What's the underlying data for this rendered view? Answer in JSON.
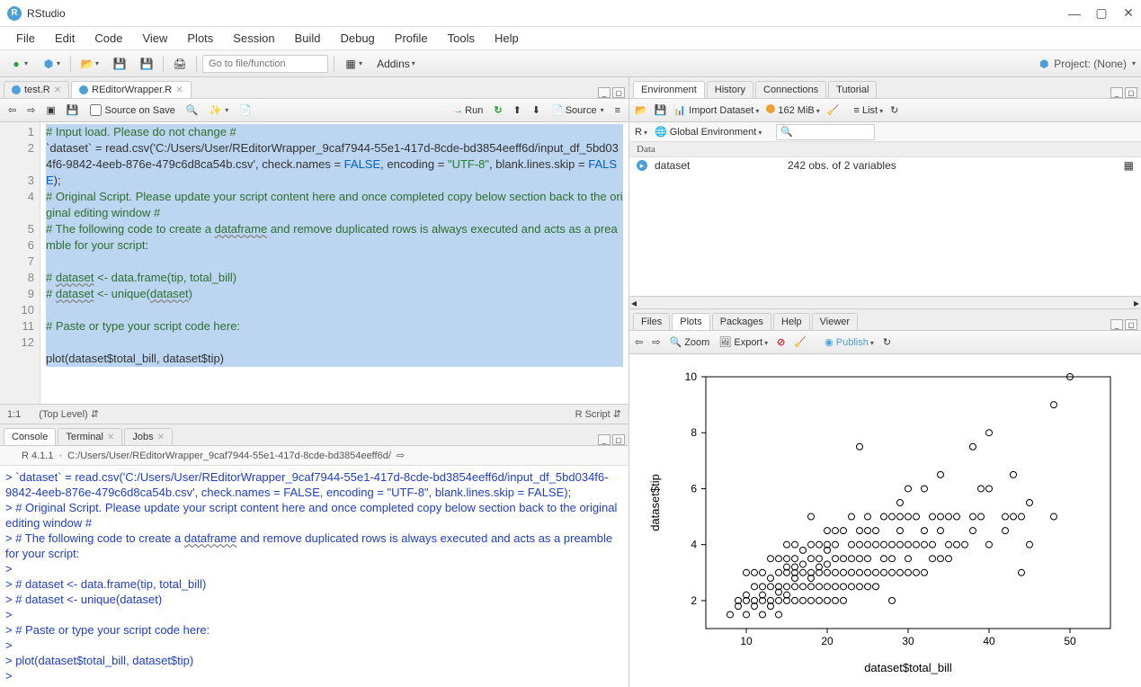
{
  "window": {
    "title": "RStudio"
  },
  "menubar": [
    "File",
    "Edit",
    "Code",
    "View",
    "Plots",
    "Session",
    "Build",
    "Debug",
    "Profile",
    "Tools",
    "Help"
  ],
  "global_toolbar": {
    "goto_placeholder": "Go to file/function",
    "addins": "Addins",
    "project": "Project: (None)"
  },
  "source": {
    "tabs": [
      {
        "label": "test.R",
        "active": false
      },
      {
        "label": "REditorWrapper.R",
        "active": true
      }
    ],
    "source_on_save": "Source on Save",
    "run_label": "Run",
    "source_label": "Source",
    "line_numbers": [
      "1",
      "2",
      "",
      "3",
      "4",
      "",
      "5",
      "6",
      "7",
      "8",
      "9",
      "10",
      "11",
      "12"
    ],
    "code_lines": [
      "# Input load. Please do not change #",
      "`dataset` = read.csv('C:/Users/User/REditorWrapper_9caf7944-55e1-417d-8cde-bd3854eeff6d/input_df_5bd034f6-9842-4eeb-876e-479c6d8ca54b.csv', check.names = FALSE, encoding = \"UTF-8\", blank.lines.skip = FALSE);",
      "# Original Script. Please update your script content here and once completed copy below section back to the original editing window #",
      "# The following code to create a dataframe and remove duplicated rows is always executed and acts as a preamble for your script:",
      "",
      "# dataset <- data.frame(tip, total_bill)",
      "# dataset <- unique(dataset)",
      "",
      "# Paste or type your script code here:",
      "",
      "plot(dataset$total_bill, dataset$tip)",
      ""
    ],
    "status_pos": "1:1",
    "status_scope": "(Top Level)",
    "status_lang": "R Script"
  },
  "console": {
    "tabs": [
      "Console",
      "Terminal",
      "Jobs"
    ],
    "version": "R 4.1.1",
    "path": "C:/Users/User/REditorWrapper_9caf7944-55e1-417d-8cde-bd3854eeff6d/",
    "lines": [
      "> `dataset` = read.csv('C:/Users/User/REditorWrapper_9caf7944-55e1-417d-8cde-bd3854eeff6d/input_df_5bd034f6-9842-4eeb-876e-479c6d8ca54b.csv', check.names = FALSE, encoding = \"UTF-8\", blank.lines.skip = FALSE);",
      "> # Original Script. Please update your script content here and once completed copy below section back to the original editing window #",
      "> # The following code to create a dataframe and remove duplicated rows is always executed and acts as a preamble for your script:",
      "> ",
      "> # dataset <- data.frame(tip, total_bill)",
      "> # dataset <- unique(dataset)",
      "> ",
      "> # Paste or type your script code here:",
      "> ",
      "> plot(dataset$total_bill, dataset$tip)",
      "> "
    ]
  },
  "environment": {
    "tabs": [
      "Environment",
      "History",
      "Connections",
      "Tutorial"
    ],
    "import": "Import Dataset",
    "memory": "162 MiB",
    "scope_r": "R",
    "scope_env": "Global Environment",
    "view_mode": "List",
    "section": "Data",
    "var_name": "dataset",
    "var_desc": "242 obs. of 2 variables"
  },
  "plots": {
    "tabs": [
      "Files",
      "Plots",
      "Packages",
      "Help",
      "Viewer"
    ],
    "zoom": "Zoom",
    "export": "Export",
    "publish": "Publish"
  },
  "chart_data": {
    "type": "scatter",
    "xlabel": "dataset$total_bill",
    "ylabel": "dataset$tip",
    "xlim": [
      5,
      55
    ],
    "ylim": [
      1,
      10
    ],
    "xticks": [
      10,
      20,
      30,
      40,
      50
    ],
    "yticks": [
      2,
      4,
      6,
      8,
      10
    ],
    "points": [
      [
        8,
        1.5
      ],
      [
        9,
        1.8
      ],
      [
        9,
        2.0
      ],
      [
        10,
        1.5
      ],
      [
        10,
        2.0
      ],
      [
        10,
        2.2
      ],
      [
        10,
        3.0
      ],
      [
        11,
        1.8
      ],
      [
        11,
        2.0
      ],
      [
        11,
        2.5
      ],
      [
        11,
        3.0
      ],
      [
        12,
        1.5
      ],
      [
        12,
        2.0
      ],
      [
        12,
        2.2
      ],
      [
        12,
        2.5
      ],
      [
        12,
        3.0
      ],
      [
        13,
        1.8
      ],
      [
        13,
        2.0
      ],
      [
        13,
        2.5
      ],
      [
        13,
        2.8
      ],
      [
        13,
        3.5
      ],
      [
        14,
        1.5
      ],
      [
        14,
        2.0
      ],
      [
        14,
        2.3
      ],
      [
        14,
        2.5
      ],
      [
        14,
        3.0
      ],
      [
        14,
        3.5
      ],
      [
        15,
        2.0
      ],
      [
        15,
        2.2
      ],
      [
        15,
        2.5
      ],
      [
        15,
        3.0
      ],
      [
        15,
        3.2
      ],
      [
        15,
        3.5
      ],
      [
        15,
        4.0
      ],
      [
        16,
        2.0
      ],
      [
        16,
        2.5
      ],
      [
        16,
        2.8
      ],
      [
        16,
        3.0
      ],
      [
        16,
        3.2
      ],
      [
        16,
        3.5
      ],
      [
        16,
        4.0
      ],
      [
        17,
        2.0
      ],
      [
        17,
        2.5
      ],
      [
        17,
        3.0
      ],
      [
        17,
        3.3
      ],
      [
        17,
        3.8
      ],
      [
        18,
        2.0
      ],
      [
        18,
        2.5
      ],
      [
        18,
        2.8
      ],
      [
        18,
        3.0
      ],
      [
        18,
        3.5
      ],
      [
        18,
        4.0
      ],
      [
        18,
        5.0
      ],
      [
        19,
        2.0
      ],
      [
        19,
        2.5
      ],
      [
        19,
        3.0
      ],
      [
        19,
        3.2
      ],
      [
        19,
        3.5
      ],
      [
        19,
        4.0
      ],
      [
        20,
        2.0
      ],
      [
        20,
        2.5
      ],
      [
        20,
        3.0
      ],
      [
        20,
        3.3
      ],
      [
        20,
        3.8
      ],
      [
        20,
        4.0
      ],
      [
        20,
        4.5
      ],
      [
        21,
        2.0
      ],
      [
        21,
        2.5
      ],
      [
        21,
        3.0
      ],
      [
        21,
        3.5
      ],
      [
        21,
        4.0
      ],
      [
        21,
        4.5
      ],
      [
        22,
        2.0
      ],
      [
        22,
        2.5
      ],
      [
        22,
        3.0
      ],
      [
        22,
        3.5
      ],
      [
        22,
        4.5
      ],
      [
        23,
        2.5
      ],
      [
        23,
        3.0
      ],
      [
        23,
        3.5
      ],
      [
        23,
        4.0
      ],
      [
        23,
        5.0
      ],
      [
        24,
        2.5
      ],
      [
        24,
        3.0
      ],
      [
        24,
        3.5
      ],
      [
        24,
        4.0
      ],
      [
        24,
        4.5
      ],
      [
        24,
        7.5
      ],
      [
        25,
        2.5
      ],
      [
        25,
        3.0
      ],
      [
        25,
        3.5
      ],
      [
        25,
        4.0
      ],
      [
        25,
        4.5
      ],
      [
        25,
        5.0
      ],
      [
        26,
        2.5
      ],
      [
        26,
        3.0
      ],
      [
        26,
        4.0
      ],
      [
        26,
        4.5
      ],
      [
        27,
        3.0
      ],
      [
        27,
        3.5
      ],
      [
        27,
        4.0
      ],
      [
        27,
        5.0
      ],
      [
        28,
        2.0
      ],
      [
        28,
        3.0
      ],
      [
        28,
        3.5
      ],
      [
        28,
        4.0
      ],
      [
        28,
        5.0
      ],
      [
        29,
        3.0
      ],
      [
        29,
        4.0
      ],
      [
        29,
        4.5
      ],
      [
        29,
        5.0
      ],
      [
        29,
        5.5
      ],
      [
        30,
        3.0
      ],
      [
        30,
        3.5
      ],
      [
        30,
        4.0
      ],
      [
        30,
        5.0
      ],
      [
        30,
        6.0
      ],
      [
        31,
        3.0
      ],
      [
        31,
        4.0
      ],
      [
        31,
        5.0
      ],
      [
        32,
        3.0
      ],
      [
        32,
        4.0
      ],
      [
        32,
        4.5
      ],
      [
        32,
        6.0
      ],
      [
        33,
        3.5
      ],
      [
        33,
        4.0
      ],
      [
        33,
        5.0
      ],
      [
        34,
        3.5
      ],
      [
        34,
        4.5
      ],
      [
        34,
        5.0
      ],
      [
        34,
        6.5
      ],
      [
        35,
        3.5
      ],
      [
        35,
        4.0
      ],
      [
        35,
        5.0
      ],
      [
        36,
        4.0
      ],
      [
        36,
        5.0
      ],
      [
        37,
        4.0
      ],
      [
        38,
        4.5
      ],
      [
        38,
        5.0
      ],
      [
        38,
        7.5
      ],
      [
        39,
        5.0
      ],
      [
        39,
        6.0
      ],
      [
        40,
        4.0
      ],
      [
        40,
        6.0
      ],
      [
        40,
        8.0
      ],
      [
        42,
        4.5
      ],
      [
        42,
        5.0
      ],
      [
        43,
        5.0
      ],
      [
        43,
        6.5
      ],
      [
        44,
        3.0
      ],
      [
        44,
        5.0
      ],
      [
        45,
        4.0
      ],
      [
        45,
        5.5
      ],
      [
        48,
        5.0
      ],
      [
        48,
        9.0
      ],
      [
        50,
        10.0
      ]
    ]
  }
}
